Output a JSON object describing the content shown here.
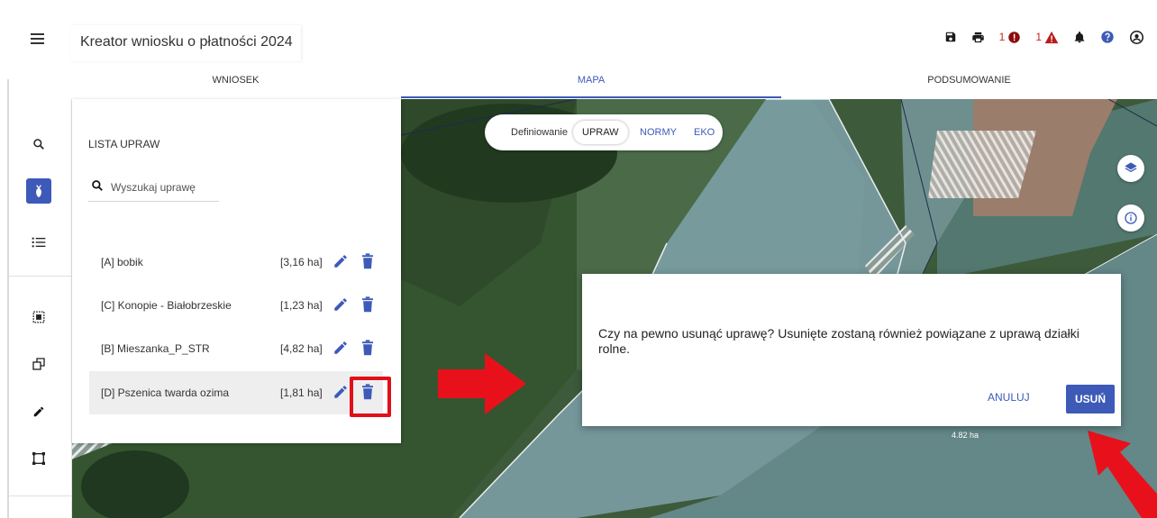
{
  "app": {
    "title": "Kreator wniosku o płatności 2024"
  },
  "header": {
    "errors_count": "1",
    "warnings_count": "1"
  },
  "tabs": [
    {
      "label": "WNIOSEK"
    },
    {
      "label": "MAPA",
      "active": true
    },
    {
      "label": "PODSUMOWANIE"
    }
  ],
  "panel": {
    "title": "LISTA UPRAW",
    "search_placeholder": "Wyszukaj uprawę",
    "crops": [
      {
        "name": "[A] bobik",
        "area": "[3,16 ha]"
      },
      {
        "name": "[C] Konopie - Białobrzeskie",
        "area": "[1,23 ha]"
      },
      {
        "name": "[B] Mieszanka_P_STR",
        "area": "[4,82 ha]"
      },
      {
        "name": "[D] Pszenica twarda ozima",
        "area": "[1,81 ha]",
        "highlighted": true
      }
    ]
  },
  "map": {
    "mode_label": "Definiowanie",
    "modes": [
      {
        "label": "UPRAW",
        "selected": true
      },
      {
        "label": "NORMY"
      },
      {
        "label": "EKO"
      }
    ],
    "field_area_label": "4.82 ha"
  },
  "dialog": {
    "message": "Czy na pewno usunąć uprawę? Usunięte zostaną również powiązane z uprawą działki rolne.",
    "cancel_label": "ANULUJ",
    "confirm_label": "USUŃ"
  },
  "icons": {
    "toolbar": [
      "search-icon",
      "crop-icon",
      "list-icon",
      "select-area-icon",
      "copy-icon",
      "pencil-icon",
      "crop-frame-icon"
    ],
    "header": [
      "save-icon",
      "print-icon",
      "error-icon",
      "warning-icon",
      "bell-icon",
      "help-icon",
      "account-icon"
    ]
  },
  "colors": {
    "accent": "#3d5ab8",
    "error": "#c62828",
    "annotation_red": "#e0101a"
  }
}
